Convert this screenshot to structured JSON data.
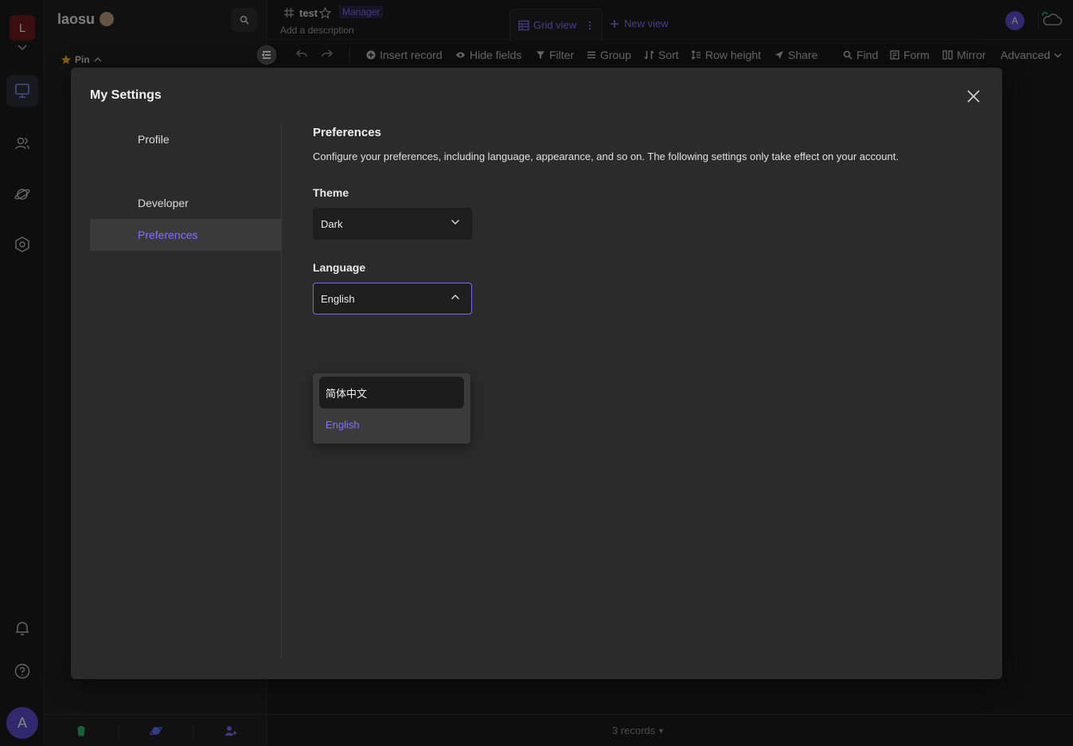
{
  "colors": {
    "accent": "#7b68ee",
    "background": "#1a1a1a",
    "modal": "#2b2b2b",
    "space_avatar": "#6b1a1a",
    "user_avatar": "#5b49c6"
  },
  "rail": {
    "space_initial": "L",
    "user_initial": "A",
    "icons": [
      "workbench-icon",
      "contacts-icon",
      "explore-icon",
      "management-icon",
      "notification-icon",
      "help-icon"
    ]
  },
  "catalog": {
    "workspace_name": "laosu",
    "pin_label": "Pin"
  },
  "header": {
    "datasheet_name": "test",
    "role": "Manager",
    "description_placeholder": "Add a description",
    "view_tab": "Grid view",
    "new_view": "New view",
    "avatar_initial": "A"
  },
  "toolbar": {
    "insert_record": "Insert record",
    "hide_fields": "Hide fields",
    "filter": "Filter",
    "group": "Group",
    "sort": "Sort",
    "row_height": "Row height",
    "share": "Share",
    "find": "Find",
    "form": "Form",
    "mirror": "Mirror",
    "advanced": "Advanced"
  },
  "footer": {
    "records": "3 records"
  },
  "modal": {
    "title": "My Settings",
    "nav": {
      "profile": "Profile",
      "developer": "Developer",
      "preferences": "Preferences"
    },
    "preferences": {
      "title": "Preferences",
      "description": "Configure your preferences, including language, appearance, and so on. The following settings only take effect on your account.",
      "theme_label": "Theme",
      "theme_value": "Dark",
      "language_label": "Language",
      "language_value": "English",
      "language_options": [
        "简体中文",
        "English"
      ]
    }
  }
}
